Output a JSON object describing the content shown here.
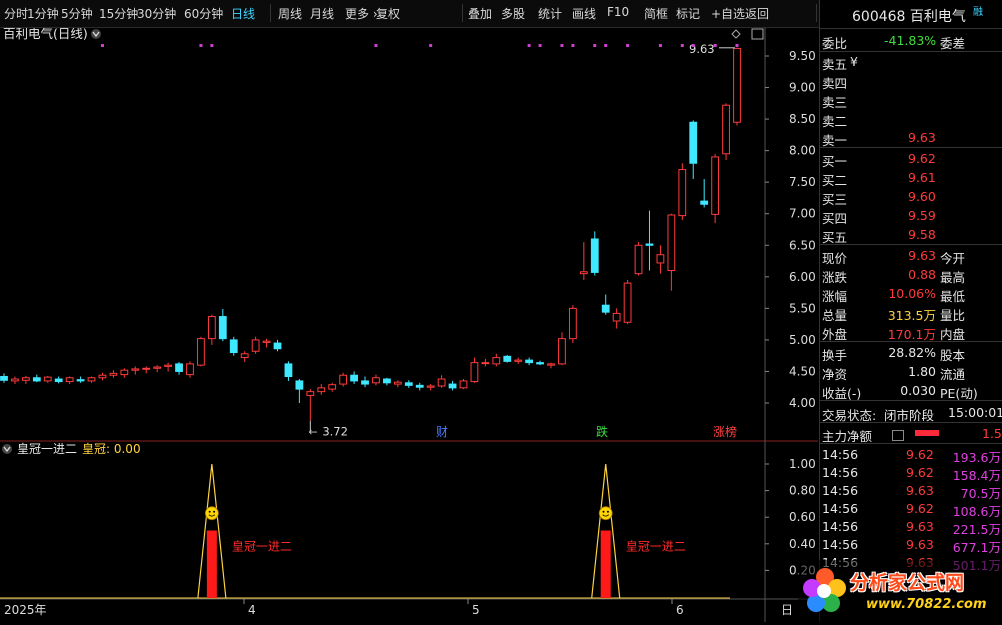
{
  "toolbar": {
    "items": [
      "分时",
      "1分钟",
      "5分钟",
      "15分钟",
      "30分钟",
      "60分钟",
      "日线",
      "周线",
      "月线",
      "更多 ›",
      "复权",
      "叠加",
      "多股",
      "统计",
      "画线",
      "F10",
      "简框",
      "标记",
      "+自选",
      "返回"
    ],
    "active": "日线"
  },
  "main_chart": {
    "title": "百利电气(日线)",
    "high_label": "9.63",
    "low_label": "3.72",
    "y_ticks": [
      "9.50",
      "9.00",
      "8.50",
      "8.00",
      "7.50",
      "7.00",
      "6.50",
      "6.00",
      "5.50",
      "5.00",
      "4.50",
      "4.00"
    ],
    "event_labels": [
      "财",
      "跌",
      "涨榜"
    ],
    "colors": {
      "up": "#ff3b3b",
      "down": "#3fe8ff",
      "event_blue": "#4a7cff",
      "event_green": "#3fdd3f",
      "event_red": "#ff4040",
      "dots": "#d040d0"
    }
  },
  "indicator": {
    "name": "皇冠一进二",
    "value_label": "皇冠: 0.00",
    "signal_text": "皇冠一进二",
    "signal_icon": "smiley-face-icon",
    "y_ticks": [
      "1.00",
      "0.80",
      "0.60",
      "0.40",
      "0.20"
    ]
  },
  "x_axis": {
    "labels": [
      "2025年",
      "4",
      "5",
      "6"
    ],
    "right_label": "日"
  },
  "chart_data": {
    "type": "candlestick",
    "title": "百利电气(日线)",
    "ylim": [
      3.6,
      9.75
    ],
    "candles": [
      {
        "o": 4.42,
        "h": 4.47,
        "l": 4.32,
        "c": 4.36
      },
      {
        "o": 4.35,
        "h": 4.42,
        "l": 4.3,
        "c": 4.38
      },
      {
        "o": 4.36,
        "h": 4.43,
        "l": 4.3,
        "c": 4.4
      },
      {
        "o": 4.4,
        "h": 4.45,
        "l": 4.33,
        "c": 4.35
      },
      {
        "o": 4.35,
        "h": 4.43,
        "l": 4.32,
        "c": 4.41
      },
      {
        "o": 4.38,
        "h": 4.42,
        "l": 4.31,
        "c": 4.34
      },
      {
        "o": 4.34,
        "h": 4.42,
        "l": 4.3,
        "c": 4.4
      },
      {
        "o": 4.37,
        "h": 4.42,
        "l": 4.32,
        "c": 4.35
      },
      {
        "o": 4.35,
        "h": 4.42,
        "l": 4.32,
        "c": 4.4
      },
      {
        "o": 4.4,
        "h": 4.48,
        "l": 4.36,
        "c": 4.44
      },
      {
        "o": 4.44,
        "h": 4.52,
        "l": 4.4,
        "c": 4.47
      },
      {
        "o": 4.45,
        "h": 4.55,
        "l": 4.4,
        "c": 4.52
      },
      {
        "o": 4.52,
        "h": 4.58,
        "l": 4.45,
        "c": 4.54
      },
      {
        "o": 4.54,
        "h": 4.58,
        "l": 4.47,
        "c": 4.55
      },
      {
        "o": 4.55,
        "h": 4.6,
        "l": 4.49,
        "c": 4.57
      },
      {
        "o": 4.58,
        "h": 4.64,
        "l": 4.5,
        "c": 4.6
      },
      {
        "o": 4.62,
        "h": 4.65,
        "l": 4.45,
        "c": 4.5
      },
      {
        "o": 4.45,
        "h": 4.66,
        "l": 4.4,
        "c": 4.62
      },
      {
        "o": 4.6,
        "h": 5.05,
        "l": 4.58,
        "c": 5.02
      },
      {
        "o": 5.02,
        "h": 5.4,
        "l": 4.92,
        "c": 5.37
      },
      {
        "o": 5.37,
        "h": 5.49,
        "l": 4.98,
        "c": 5.02
      },
      {
        "o": 5.0,
        "h": 5.05,
        "l": 4.75,
        "c": 4.8
      },
      {
        "o": 4.72,
        "h": 4.82,
        "l": 4.65,
        "c": 4.78
      },
      {
        "o": 4.82,
        "h": 5.05,
        "l": 4.78,
        "c": 5.0
      },
      {
        "o": 4.96,
        "h": 5.02,
        "l": 4.88,
        "c": 4.98
      },
      {
        "o": 4.95,
        "h": 5.0,
        "l": 4.82,
        "c": 4.86
      },
      {
        "o": 4.62,
        "h": 4.66,
        "l": 4.35,
        "c": 4.42
      },
      {
        "o": 4.35,
        "h": 4.38,
        "l": 4.0,
        "c": 4.22
      },
      {
        "o": 4.12,
        "h": 4.22,
        "l": 3.72,
        "c": 4.18
      },
      {
        "o": 4.18,
        "h": 4.3,
        "l": 4.13,
        "c": 4.24
      },
      {
        "o": 4.22,
        "h": 4.32,
        "l": 4.18,
        "c": 4.29
      },
      {
        "o": 4.3,
        "h": 4.48,
        "l": 4.26,
        "c": 4.44
      },
      {
        "o": 4.44,
        "h": 4.5,
        "l": 4.3,
        "c": 4.35
      },
      {
        "o": 4.35,
        "h": 4.42,
        "l": 4.25,
        "c": 4.3
      },
      {
        "o": 4.32,
        "h": 4.45,
        "l": 4.28,
        "c": 4.4
      },
      {
        "o": 4.38,
        "h": 4.4,
        "l": 4.28,
        "c": 4.32
      },
      {
        "o": 4.3,
        "h": 4.36,
        "l": 4.25,
        "c": 4.33
      },
      {
        "o": 4.32,
        "h": 4.36,
        "l": 4.24,
        "c": 4.28
      },
      {
        "o": 4.28,
        "h": 4.32,
        "l": 4.2,
        "c": 4.25
      },
      {
        "o": 4.25,
        "h": 4.3,
        "l": 4.2,
        "c": 4.27
      },
      {
        "o": 4.27,
        "h": 4.44,
        "l": 4.24,
        "c": 4.38
      },
      {
        "o": 4.3,
        "h": 4.35,
        "l": 4.2,
        "c": 4.24
      },
      {
        "o": 4.24,
        "h": 4.38,
        "l": 4.22,
        "c": 4.35
      },
      {
        "o": 4.34,
        "h": 4.72,
        "l": 4.32,
        "c": 4.64
      },
      {
        "o": 4.64,
        "h": 4.7,
        "l": 4.58,
        "c": 4.64
      },
      {
        "o": 4.62,
        "h": 4.78,
        "l": 4.58,
        "c": 4.72
      },
      {
        "o": 4.74,
        "h": 4.76,
        "l": 4.64,
        "c": 4.66
      },
      {
        "o": 4.66,
        "h": 4.72,
        "l": 4.62,
        "c": 4.68
      },
      {
        "o": 4.68,
        "h": 4.72,
        "l": 4.6,
        "c": 4.64
      },
      {
        "o": 4.64,
        "h": 4.67,
        "l": 4.6,
        "c": 4.62
      },
      {
        "o": 4.6,
        "h": 4.64,
        "l": 4.55,
        "c": 4.62
      },
      {
        "o": 4.62,
        "h": 5.12,
        "l": 4.6,
        "c": 5.02
      },
      {
        "o": 5.02,
        "h": 5.55,
        "l": 4.95,
        "c": 5.5
      },
      {
        "o": 6.05,
        "h": 6.55,
        "l": 5.95,
        "c": 6.08
      },
      {
        "o": 6.6,
        "h": 6.72,
        "l": 6.02,
        "c": 6.07
      },
      {
        "o": 5.55,
        "h": 5.72,
        "l": 5.4,
        "c": 5.44
      },
      {
        "o": 5.3,
        "h": 5.5,
        "l": 5.18,
        "c": 5.42
      },
      {
        "o": 5.28,
        "h": 5.95,
        "l": 5.25,
        "c": 5.9
      },
      {
        "o": 6.05,
        "h": 6.55,
        "l": 6.02,
        "c": 6.5
      },
      {
        "o": 6.52,
        "h": 7.05,
        "l": 6.1,
        "c": 6.5
      },
      {
        "o": 6.22,
        "h": 6.5,
        "l": 6.05,
        "c": 6.35
      },
      {
        "o": 6.1,
        "h": 7.0,
        "l": 5.78,
        "c": 6.98
      },
      {
        "o": 6.97,
        "h": 7.8,
        "l": 6.9,
        "c": 7.7
      },
      {
        "o": 8.45,
        "h": 8.48,
        "l": 7.55,
        "c": 7.8
      },
      {
        "o": 7.2,
        "h": 7.55,
        "l": 7.1,
        "c": 7.15
      },
      {
        "o": 6.99,
        "h": 7.95,
        "l": 6.85,
        "c": 7.9
      },
      {
        "o": 7.95,
        "h": 8.75,
        "l": 7.85,
        "c": 8.72
      },
      {
        "o": 8.45,
        "h": 9.63,
        "l": 8.4,
        "c": 9.62
      }
    ],
    "signals": [
      {
        "index": 19,
        "value": 1.0,
        "label": "皇冠一进二"
      },
      {
        "index": 55,
        "value": 1.0,
        "label": "皇冠一进二"
      }
    ]
  },
  "side_panel": {
    "code": "600468",
    "name": "百利电气",
    "badge": "融",
    "weibi_label": "委比",
    "weibi_value": "-41.83%",
    "weicha_label": "委差",
    "sell": [
      {
        "label": "卖五",
        "price": "¥",
        "vol": ""
      },
      {
        "label": "卖四",
        "price": "",
        "vol": ""
      },
      {
        "label": "卖三",
        "price": "",
        "vol": ""
      },
      {
        "label": "卖二",
        "price": "",
        "vol": ""
      },
      {
        "label": "卖一",
        "price": "9.63",
        "vol": ""
      }
    ],
    "buy": [
      {
        "label": "买一",
        "price": "9.62",
        "vol": ""
      },
      {
        "label": "买二",
        "price": "9.61",
        "vol": ""
      },
      {
        "label": "买三",
        "price": "9.60",
        "vol": ""
      },
      {
        "label": "买四",
        "price": "9.59",
        "vol": ""
      },
      {
        "label": "买五",
        "price": "9.58",
        "vol": ""
      }
    ],
    "quote": [
      {
        "l1": "现价",
        "v1": "9.63",
        "l2": "今开",
        "c": "red"
      },
      {
        "l1": "涨跌",
        "v1": "0.88",
        "l2": "最高",
        "c": "red"
      },
      {
        "l1": "涨幅",
        "v1": "10.06%",
        "l2": "最低",
        "c": "red"
      },
      {
        "l1": "总量",
        "v1": "313.5万",
        "l2": "量比",
        "c": "yellow"
      },
      {
        "l1": "外盘",
        "v1": "170.1万",
        "l2": "内盘",
        "c": "red"
      }
    ],
    "stats": [
      {
        "l1": "换手",
        "v1": "28.82%",
        "l2": "股本"
      },
      {
        "l1": "净资",
        "v1": "1.80",
        "l2": "流通"
      },
      {
        "l1": "收益(-)",
        "v1": "0.030",
        "l2": "PE(动)"
      }
    ],
    "trade_state_label": "交易状态:",
    "trade_state": "闭市阶段",
    "trade_time": "15:00:01",
    "main_flow_label": "主力净额",
    "main_flow_value": "1.50",
    "ticks": [
      {
        "time": "14:56",
        "price": "9.62",
        "vol": "193.6万"
      },
      {
        "time": "14:56",
        "price": "9.62",
        "vol": "158.4万"
      },
      {
        "time": "14:56",
        "price": "9.63",
        "vol": "70.5万"
      },
      {
        "time": "14:56",
        "price": "9.62",
        "vol": "108.6万"
      },
      {
        "time": "14:56",
        "price": "9.63",
        "vol": "221.5万"
      },
      {
        "time": "14:56",
        "price": "9.63",
        "vol": "677.1万"
      },
      {
        "time": "14:56",
        "price": "9.63",
        "vol": "501.1万"
      }
    ],
    "watermark": {
      "title": "分析家公式网",
      "url": "www.70822.com"
    }
  }
}
